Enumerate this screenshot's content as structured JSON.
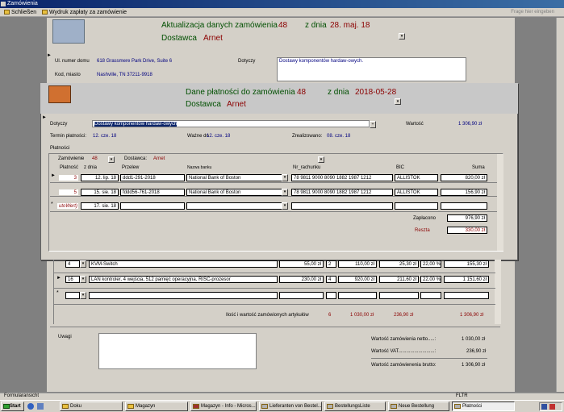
{
  "window": {
    "title": "Zamówienia"
  },
  "menu": {
    "close": "Schließen",
    "print": "Wydruk zapłaty za zamówienie",
    "search_placeholder": "Frage hier eingeben"
  },
  "order_form": {
    "title": "Aktualizacja danych zamówienia",
    "number": "48",
    "date_label": "z dnia",
    "date": "28. maj. 18",
    "supplier_label": "Dostawca",
    "supplier": "Arnet",
    "street_label": "Ul. numer domu",
    "street": "618 Grassmere Park Drive, Suite 6",
    "city_label": "Kod, miasto",
    "city": "Nashville, TN 37211-9918",
    "regarding_label": "Dotyczy",
    "regarding": "Dostawy komponentów hardaw-owych."
  },
  "payment_form": {
    "title": "Dane płatności do zamówienia",
    "number": "48",
    "date_label": "z dnia",
    "date": "2018-05-28",
    "supplier_label": "Dostawca",
    "supplier": "Arnet",
    "regarding_label": "Dotyczy",
    "regarding": "Dostawy komponentów hardaw-owych",
    "value_label": "Wartość",
    "value": "1 306,90 zł",
    "terms_label": "Termin płatności:",
    "terms": "12. cze. 18",
    "valid_label": "Ważne do",
    "valid": "12. cze. 18",
    "realized_label": "Zrealizowano:",
    "realized": "08. cze. 18",
    "payments_label": "Płatności",
    "sub_order_label": "Zamówienie",
    "sub_order": "48",
    "sub_supplier_label": "Dostawca:",
    "sub_supplier": "Arnet",
    "columns": {
      "payment": "Płatność",
      "date": "z dnia",
      "transfer": "Przelew",
      "bank": "Nazwa banku",
      "account": "Nr_rachunku",
      "bic": "BIC",
      "sum": "Suma"
    },
    "rows": [
      {
        "no": "3",
        "date": "12. lip. 18",
        "transfer": "ddd1-291-2018",
        "bank": "National Bank of Boston",
        "account": "78 9811 9000 8090 1882 1987 1212",
        "bic": "ALLISTOK",
        "sum": "820,00 zł"
      },
      {
        "no": "5",
        "date": "15. sie. 18",
        "transfer": "fddd56-761-2018",
        "bank": "National Bank of Boston",
        "account": "78 9811 9000 8090 1882 1987 1212",
        "bic": "ALLISTOK",
        "sum": "156,90 zł"
      }
    ],
    "new_row": {
      "no": "utoWert)",
      "date": "17. sie. 18"
    },
    "paid_label": "Zapłacono",
    "paid": "976,90 zł",
    "rest_label": "Reszta",
    "rest": "330,00 zł"
  },
  "items": [
    {
      "qty_sel": "4",
      "desc": "KVM-Switch",
      "price": "55,00 zł",
      "qty": "2",
      "net": "110,00 zł",
      "vat": "25,30 zł",
      "vatp": "22,00 %",
      "gross": "155,30 zł"
    },
    {
      "qty_sel": "16",
      "desc": "LAN kontroler, 4 wejścia, 512 pamięć operacyjna, RISC-prozesor",
      "price": "230,00 zł",
      "qty": "4",
      "net": "920,00 zł",
      "vat": "211,60 zł",
      "vatp": "22,00 %",
      "gross": "1 151,60 zł"
    }
  ],
  "items_footer": {
    "label": "Ilość i wartość zamówionych artykułów",
    "count": "6",
    "net": "1 030,00 zł",
    "vat": "236,90 zł",
    "gross": "1 306,90 zł"
  },
  "summary": {
    "notes_label": "Uwagi",
    "net_label": "Wartość zamówienia netto.....:",
    "net": "1 030,00 zł",
    "vat_label": "Wartość VAT...........................:",
    "vat": "236,90 zł",
    "gross_label": "Wartość zamówienenia brutto:",
    "gross": "1 306,90 zł"
  },
  "status": {
    "left": "Formularansicht",
    "right": "FLTR"
  },
  "taskbar": {
    "start": "Start",
    "items": [
      "Doku",
      "Magazyn",
      "Magazyn - Info - Micros...",
      "Lieferanten von Bestel...",
      "BestellungsListe",
      "Neue Bestellung",
      "Płatności"
    ]
  }
}
